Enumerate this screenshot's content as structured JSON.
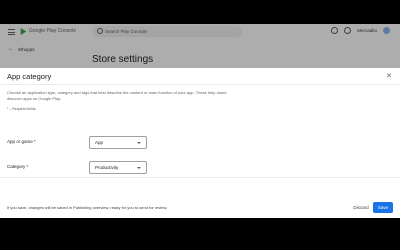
{
  "header": {
    "brand": "Google Play Console",
    "search_placeholder": "Search Play Console",
    "account_name": "Mercadito"
  },
  "breadcrumb": {
    "app_name": "Whopps"
  },
  "page": {
    "title": "Store settings"
  },
  "dialog": {
    "title": "App category",
    "description": "Choose an application type, category and tags that best describe the content or main function of your app. These help users discover apps on Google Play.",
    "required_note": "* – Required fields",
    "fields": [
      {
        "label": "App or game *",
        "value": "App"
      },
      {
        "label": "Category *",
        "value": "Productivity"
      }
    ]
  },
  "footer": {
    "note": "If you save, changes will be saved in Publishing overview, ready for you to send for review.",
    "discard_label": "Discard",
    "save_label": "Save"
  },
  "colors": {
    "primary": "#1a73e8"
  }
}
